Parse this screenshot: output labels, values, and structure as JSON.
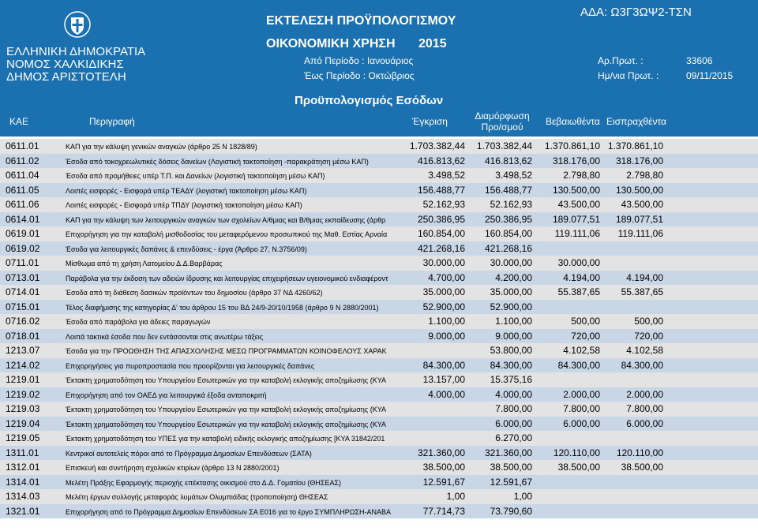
{
  "header": {
    "org_lines": [
      "ΕΛΛΗΝΙΚΗ ΔΗΜΟΚΡΑΤΙΑ",
      "ΝΟΜΟΣ ΧΑΛΚΙΔΙΚΗΣ",
      "ΔΗΜΟΣ ΑΡΙΣΤΟΤΕΛΗ"
    ],
    "title": "ΕΚΤΕΛΕΣΗ ΠΡΟΫΠΟΛΟΓΙΣΜΟΥ",
    "subtitle": "ΟΙΚΟΝΟΜΙΚΗ ΧΡΗΣΗ",
    "year": "2015",
    "period_from": "Από Περίοδο : Ιανουάριος",
    "period_to": "Έως Περίοδο : Οκτώβριος",
    "ada": "ΑΔΑ: Ω3Γ3ΩΨ2-ΤΣΝ",
    "protocol_label": "Αρ.Πρωτ. :",
    "protocol_value": "33606",
    "date_label": "Ημ/νια Πρωτ. :",
    "date_value": "09/11/2015",
    "section_title": "Προϋπολογισμός Εσόδων",
    "bg_color": "#1B70B0",
    "emblem_icon": "greek-coat-of-arms-icon"
  },
  "columns": {
    "kae": "ΚΑΕ",
    "desc": "Περιγραφή",
    "approval": "Έγκριση",
    "adjusted_line1": "Διαμόρφωση",
    "adjusted_line2": "Προ/σμού",
    "assessed": "Βεβαιωθέντα",
    "collected": "Εισπραχθέντα"
  },
  "rows": [
    [
      "0611.01",
      "ΚΑΠ για την κάλυψη γενικών αναγκών (άρθρο 25 Ν 1828/89)",
      "1.703.382,44",
      "1.703.382,44",
      "1.370.861,10",
      "1.370.861,10"
    ],
    [
      "0611.02",
      "Έσοδα από τοκοχρεωλυτικές δόσεις δανείων (Λογιστική τακτοποίηση -παρακράτηση μέσω ΚΑΠ)",
      "416.813,62",
      "416.813,62",
      "318.176,00",
      "318.176,00"
    ],
    [
      "0611.04",
      "Έσοδα από προμήθειες υπέρ Τ.Π. και Δανείων (λογιστική τακτοποίηση μέσω ΚΑΠ)",
      "3.498,52",
      "3.498,52",
      "2.798,80",
      "2.798,80"
    ],
    [
      "0611.05",
      "Λοιπές εισφορές - Εισφορά υπέρ ΤΕΑΔΥ (λογιστική τακτοποίηση μέσω ΚΑΠ)",
      "156.488,77",
      "156.488,77",
      "130.500,00",
      "130.500,00"
    ],
    [
      "0611.06",
      "Λοιπές εισφορές - Εισφορά υπέρ ΤΠΔΥ (λογιστική τακτοποίηση μέσω ΚΑΠ)",
      "52.162,93",
      "52.162,93",
      "43.500,00",
      "43.500,00"
    ],
    [
      "0614.01",
      "ΚΑΠ για την κάλυψη των λειτουργικών αναγκών των σχολείων Α/θμιας και Β/θμιας εκπαίδευσης (άρθρ",
      "250.386,95",
      "250.386,95",
      "189.077,51",
      "189.077,51"
    ],
    [
      "0619.01",
      "Επιχορήγηση για την καταβολή μισθοδοσίας του μεταφερόμενου προσωπικού της Μαθ. Εστίας Αρναία",
      "160.854,00",
      "160.854,00",
      "119.111,06",
      "119.111,06"
    ],
    [
      "0619.02",
      "Έσοδα για λειτουργικές δαπάνες & επενδύσεις - έργα (Άρθρο 27, Ν.3756/09)",
      "421.268,16",
      "421.268,16",
      "",
      ""
    ],
    [
      "0711.01",
      "Μίσθωμα από τη χρήση Λατομείου Δ.Δ.Βαρβάρας",
      "30.000,00",
      "30.000,00",
      "30.000,00",
      ""
    ],
    [
      "0713.01",
      "Παράβολα για την έκδοση των αδειών ίδρυσης και λειτουργίας επιχειρήσεων υγειονομικού ενδιαφέροντ",
      "4.700,00",
      "4.200,00",
      "4.194,00",
      "4.194,00"
    ],
    [
      "0714.01",
      "Έσοδα από τη διάθεση δασικών προϊόντων του δημοσίου (άρθρο 37 ΝΔ 4260/62)",
      "35.000,00",
      "35.000,00",
      "55.387,65",
      "55.387,65"
    ],
    [
      "0715.01",
      "Τέλος διαφήμισης της κατηγορίας Δ' του άρθρου 15 του ΒΔ 24/9-20/10/1958 (άρθρο 9 Ν 2880/2001)",
      "52.900,00",
      "52.900,00",
      "",
      ""
    ],
    [
      "0716.02",
      "Έσοδα από παράβολα για άδειες παραγωγών",
      "1.100,00",
      "1.100,00",
      "500,00",
      "500,00"
    ],
    [
      "0718.01",
      "Λοιπά τακτικά έσοδα που δεν εντάσσονται στις ανωτέρω τάξεις",
      "9.000,00",
      "9.000,00",
      "720,00",
      "720,00"
    ],
    [
      "1213.07",
      "Έσοδα για την ΠΡΟΩΘΗΣΗ ΤΗΣ ΑΠΑΣΧΟΛΗΣΗΣ ΜΕΣΩ ΠΡΟΓΡΑΜΜΑΤΩΝ ΚΟΙΝΟΦΕΛΟΥΣ ΧΑΡΑΚ",
      "",
      "53.800,00",
      "4.102,58",
      "4.102,58"
    ],
    [
      "1214.02",
      "Επιχορηγήσεις για πυροπροστασία που προορίζονται για λειτουργικές δαπάνες",
      "84.300,00",
      "84.300,00",
      "84.300,00",
      "84.300,00"
    ],
    [
      "1219.01",
      "Έκτακτη χρηματοδότηση του Υπουργείου Εσωτερικών για την καταβολή εκλογικής αποζημίωσης (ΚΥΑ",
      "13.157,00",
      "15.375,16",
      "",
      ""
    ],
    [
      "1219.02",
      "Επιχορήγηση από τον ΟΑΕΔ για λειτουργικά έξοδα ανταποκριτή",
      "4.000,00",
      "4.000,00",
      "2.000,00",
      "2.000,00"
    ],
    [
      "1219.03",
      "Έκτακτη χρηματοδότηση του Υπουργείου Εσωτερικών για την καταβολή εκλογικής αποζημίωσης (ΚΥΑ",
      "",
      "7.800,00",
      "7.800,00",
      "7.800,00"
    ],
    [
      "1219.04",
      "Έκτακτη χρηματοδότηση του Υπουργείου Εσωτερικών για την καταβολή εκλογικής αποζημίωσης (ΚΥΑ",
      "",
      "6.000,00",
      "6.000,00",
      "6.000,00"
    ],
    [
      "1219.05",
      "Έκτακτη χρηματοδότηση του ΥΠΕΣ για την καταβολή ειδικής εκλογικής αποζημίωσης [ΚΥΑ 31842/201",
      "",
      "6.270,00",
      "",
      ""
    ],
    [
      "1311.01",
      "Κεντρικοί αυτοτελείς πόροι από το Πρόγραμμα Δημοσίων Επενδύσεων (ΣΑΤΑ)",
      "321.360,00",
      "321.360,00",
      "120.110,00",
      "120.110,00"
    ],
    [
      "1312.01",
      "Επισκευή και συντήρηση σχολικών κτιρίων (άρθρο 13 Ν 2880/2001)",
      "38.500,00",
      "38.500,00",
      "38.500,00",
      "38.500,00"
    ],
    [
      "1314.01",
      "Μελέτη Πράξης Εφαρμογής περιοχής επέκτασης οικισμού στο Δ.Δ. Γοματίου (ΘΗΣΕΑΣ)",
      "12.591,67",
      "12.591,67",
      "",
      ""
    ],
    [
      "1314.03",
      "Μελέτη έργων συλλογής μεταφοράς λυμάτων Ολυμπιάδας (τροποποίηση) ΘΗΣΕΑΣ",
      "1,00",
      "1,00",
      "",
      ""
    ],
    [
      "1321.01",
      "Επιχορήγηση από το Πρόγραμμα Δημοσίων Επενδύσεων ΣΑ Ε016 για το έργο ΣΥΜΠΛΗΡΩΣΗ-ΑΝΑΒΑ",
      "77.714,73",
      "73.790,60",
      "",
      ""
    ]
  ]
}
